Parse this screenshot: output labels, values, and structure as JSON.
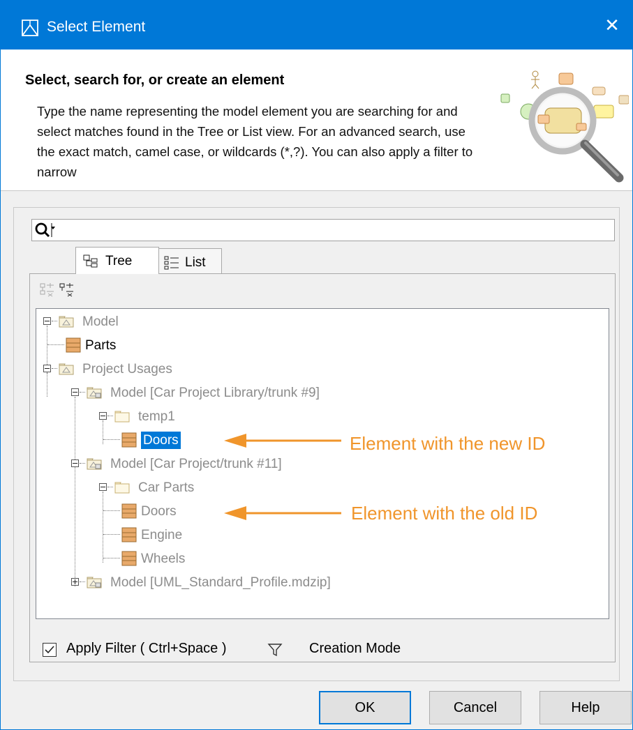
{
  "window": {
    "title": "Select Element",
    "close": "✕"
  },
  "header": {
    "title": "Select, search for, or create an element",
    "description": "Type the name representing the model element you are searching for and select matches found in the Tree or List view. For an advanced search, use the exact match, camel case, or wildcards (*,?). You can also apply a filter to narrow"
  },
  "search": {
    "value": "",
    "placeholder": ""
  },
  "tabs": [
    {
      "label": "Tree",
      "active": true
    },
    {
      "label": "List",
      "active": false
    }
  ],
  "tree": [
    {
      "label": "Model",
      "style": "gray",
      "icon": "package-icon",
      "expander": "minus"
    },
    {
      "label": "Parts",
      "style": "black",
      "icon": "class-icon"
    },
    {
      "label": "Project Usages",
      "style": "gray",
      "icon": "package-icon",
      "expander": "minus"
    },
    {
      "label": "Model [Car Project Library/trunk #9]",
      "style": "gray",
      "icon": "used-project-icon",
      "expander": "minus"
    },
    {
      "label": "temp1",
      "style": "gray",
      "icon": "folder-icon",
      "expander": "minus"
    },
    {
      "label": "Doors",
      "style": "selected",
      "icon": "class-icon"
    },
    {
      "label": "Model [Car Project/trunk #11]",
      "style": "gray",
      "icon": "used-project-icon",
      "expander": "minus"
    },
    {
      "label": "Car Parts",
      "style": "gray",
      "icon": "folder-icon",
      "expander": "minus"
    },
    {
      "label": "Doors",
      "style": "gray",
      "icon": "class-icon"
    },
    {
      "label": "Engine",
      "style": "gray",
      "icon": "class-icon"
    },
    {
      "label": "Wheels",
      "style": "gray",
      "icon": "class-icon"
    },
    {
      "label": "Model [UML_Standard_Profile.mdzip]",
      "style": "gray",
      "icon": "used-project-icon",
      "expander": "plus"
    }
  ],
  "annotations": [
    {
      "text": "Element with the new ID"
    },
    {
      "text": "Element with the old ID"
    }
  ],
  "filter": {
    "label": "Apply Filter ( Ctrl+Space )",
    "checked": true
  },
  "creation_mode": "Creation Mode",
  "buttons": {
    "ok": "OK",
    "cancel": "Cancel",
    "help": "Help"
  },
  "colors": {
    "titlebar": "#0078d7",
    "selection": "#0078d7",
    "annotation": "#f0952b",
    "class_icon": "#e8a96a"
  }
}
